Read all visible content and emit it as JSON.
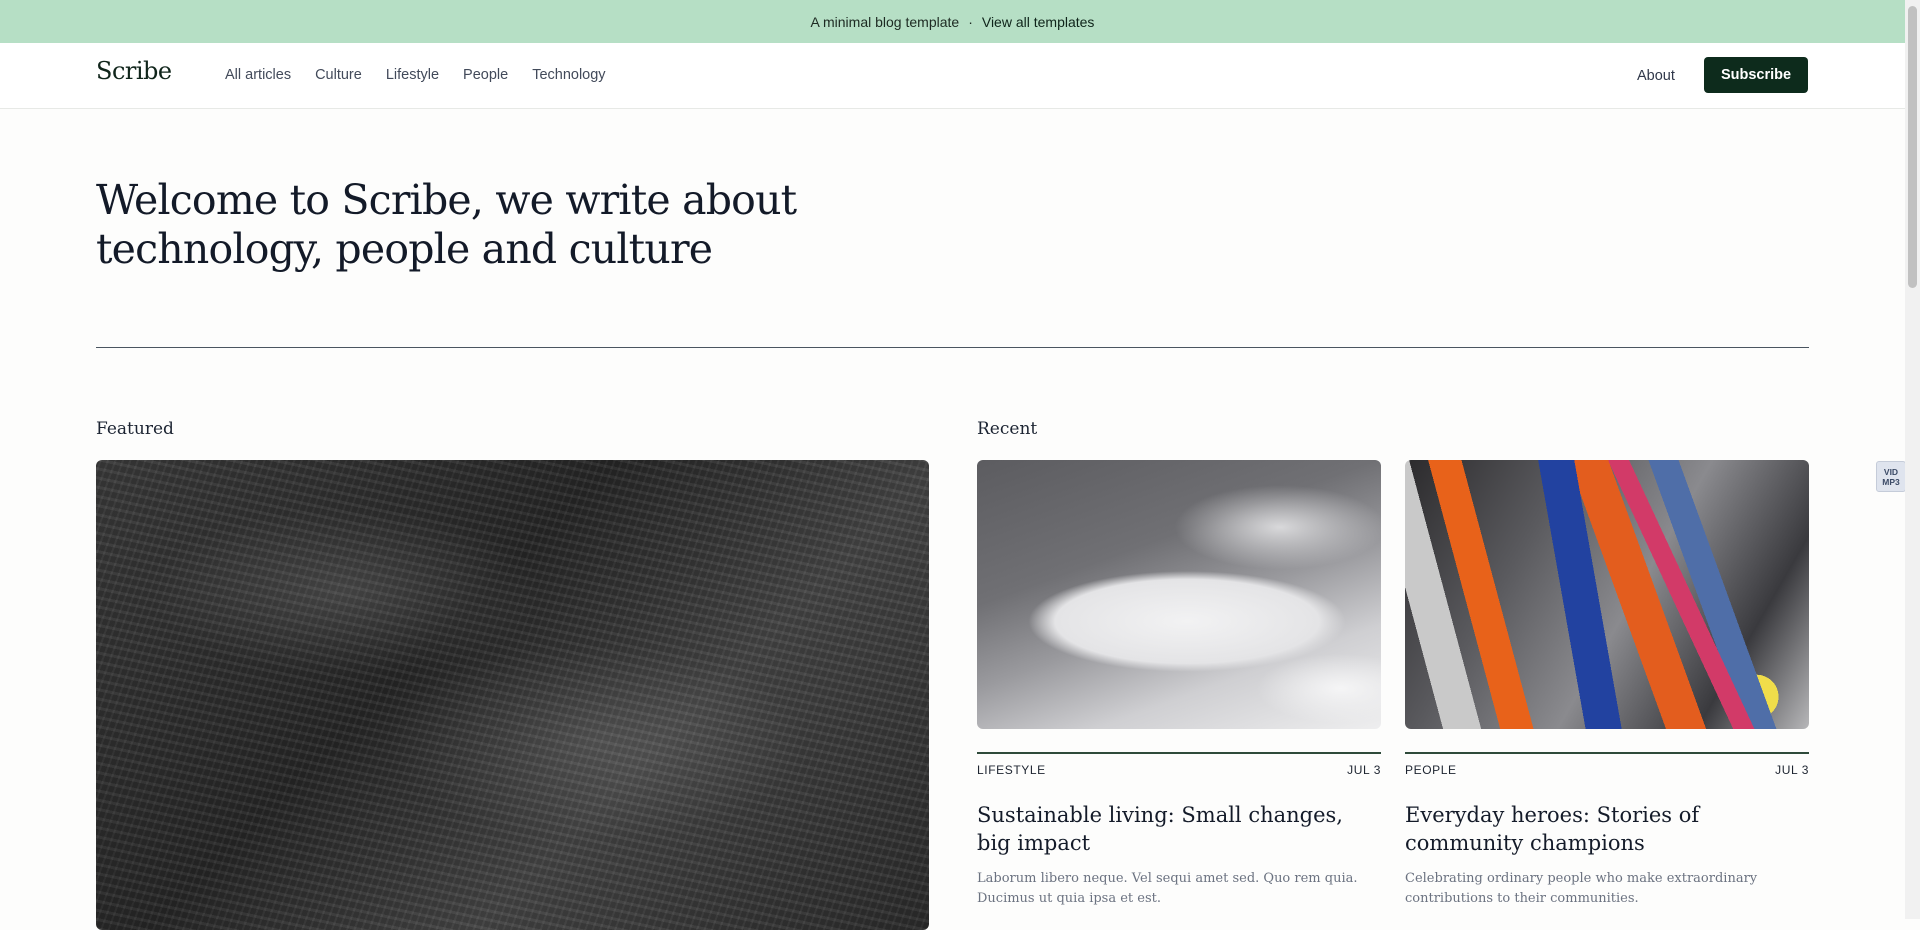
{
  "banner": {
    "text": "A minimal blog template",
    "separator": "·",
    "link": "View all templates"
  },
  "nav": {
    "logo": "Scribe",
    "links": [
      "All articles",
      "Culture",
      "Lifestyle",
      "People",
      "Technology"
    ],
    "about": "About",
    "subscribe": "Subscribe"
  },
  "hero": {
    "line1": "Welcome to Scribe, we write about",
    "line2": "technology, people and culture"
  },
  "sections": {
    "featured": "Featured",
    "recent": "Recent"
  },
  "recent_posts": [
    {
      "category": "LIFESTYLE",
      "date": "JUL 3",
      "title": "Sustainable living: Small changes, big impact",
      "excerpt": "Laborum libero neque. Vel sequi amet sed. Quo rem quia. Ducimus ut quia ipsa et est."
    },
    {
      "category": "PEOPLE",
      "date": "JUL 3",
      "title": "Everyday heroes: Stories of community champions",
      "excerpt": "Celebrating ordinary people who make extraordinary contributions to their communities."
    }
  ],
  "extension_badge": {
    "line1": "VID",
    "line2": "MP3"
  },
  "colors": {
    "banner_bg": "#b6dfc5",
    "brand_dark": "#0d2b1c",
    "page_bg": "#fdfdfc"
  }
}
